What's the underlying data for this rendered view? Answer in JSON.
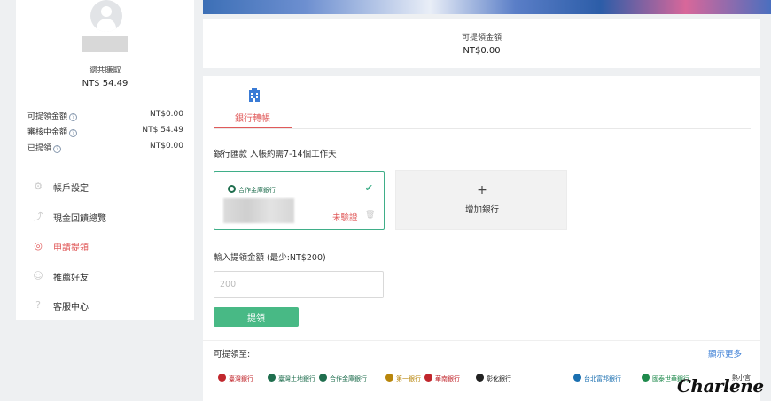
{
  "sidebar": {
    "total_label": "總共賺取",
    "total_value": "NT$ 54.49",
    "balances": [
      {
        "label": "可提領金額",
        "value": "NT$0.00"
      },
      {
        "label": "審核中金額",
        "value": "NT$ 54.49"
      },
      {
        "label": "已提領",
        "value": "NT$0.00"
      }
    ],
    "menu": [
      {
        "label": "帳戶設定",
        "icon": "gear-icon"
      },
      {
        "label": "現金回饋總覽",
        "icon": "trend-icon"
      },
      {
        "label": "申請提領",
        "icon": "withdraw-icon"
      },
      {
        "label": "推薦好友",
        "icon": "invite-icon"
      },
      {
        "label": "客服中心",
        "icon": "help-icon"
      }
    ]
  },
  "summary": {
    "label": "可提領金額",
    "value": "NT$0.00"
  },
  "withdraw": {
    "tab_label": "銀行轉帳",
    "note": "銀行匯款 入帳約需7-14個工作天",
    "bank_card": {
      "bank_name": "合作金庫銀行",
      "status": "未驗證"
    },
    "add_bank": {
      "plus": "+",
      "label": "增加銀行"
    },
    "amount_label": "輸入提領金額 (最少:NT$200)",
    "amount_placeholder": "200",
    "submit_label": "提領",
    "banks_title": "可提領至:",
    "show_more": "顯示更多",
    "banks": [
      {
        "name": "臺灣銀行",
        "color": "#c1272d"
      },
      {
        "name": "臺灣土地銀行",
        "color": "#1f6e4e"
      },
      {
        "name": "合作金庫銀行",
        "color": "#1f6e4e"
      },
      {
        "name": "第一銀行",
        "color": "#b8860b"
      },
      {
        "name": "華南銀行",
        "color": "#c1272d"
      },
      {
        "name": "彰化銀行",
        "color": "#222222"
      },
      {
        "name": "台北富邦銀行",
        "color": "#1a6fb0"
      },
      {
        "name": "國泰世華銀行",
        "color": "#1f8a4c"
      }
    ]
  },
  "watermark": {
    "text": "Charlene",
    "sub": "熱小言"
  }
}
